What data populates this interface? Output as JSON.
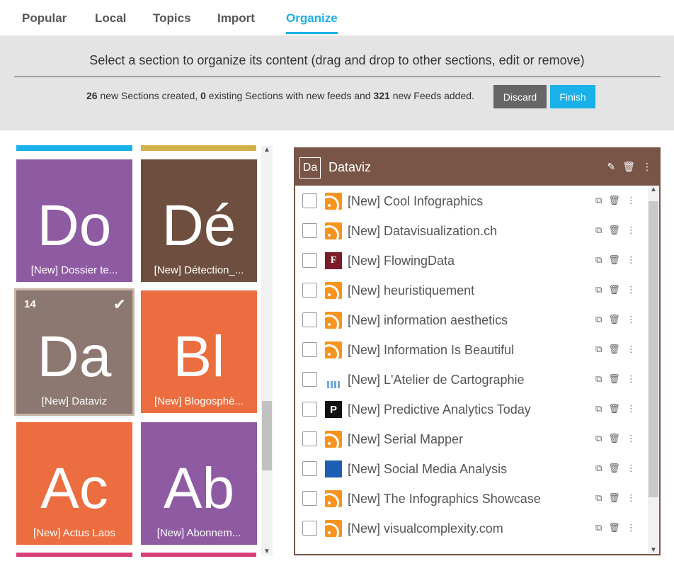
{
  "tabs": [
    "Popular",
    "Local",
    "Topics",
    "Import",
    "Organize"
  ],
  "banner": {
    "title": "Select a section to organize its content (drag and drop to other sections, edit or remove)",
    "new_sections": "26",
    "text1": " new Sections created, ",
    "existing_sections": "0",
    "text2": " existing Sections with new feeds and ",
    "new_feeds": "321",
    "text3": " new Feeds added.",
    "discard": "Discard",
    "finish": "Finish"
  },
  "tiles": [
    {
      "abbr": "Do",
      "caption": "[New] Dossier te...",
      "color": "#8e5ba3"
    },
    {
      "abbr": "Dé",
      "caption": "[New] Détection_...",
      "color": "#6e4e3f"
    },
    {
      "abbr": "Da",
      "caption": "[New] Dataviz",
      "color": "#8c7870",
      "count": "14",
      "check": "✔"
    },
    {
      "abbr": "Bl",
      "caption": "[New] Blogosphè...",
      "color": "#ec6d3f"
    },
    {
      "abbr": "Ac",
      "caption": "[New] Actus Laos",
      "color": "#ec6d3f"
    },
    {
      "abbr": "Ab",
      "caption": "[New] Abonnem...",
      "color": "#8e5ba3"
    }
  ],
  "panel": {
    "badge": "Da",
    "title": "Dataviz",
    "color": "#795548"
  },
  "feeds": [
    {
      "name": "[New] Cool Infographics",
      "icon": "rss"
    },
    {
      "name": "[New] Datavisualization.ch",
      "icon": "rss"
    },
    {
      "name": "[New] FlowingData",
      "icon": "flowingdata"
    },
    {
      "name": "[New] heuristiquement",
      "icon": "rss"
    },
    {
      "name": "[New] information aesthetics",
      "icon": "rss"
    },
    {
      "name": "[New] Information Is Beautiful",
      "icon": "rss"
    },
    {
      "name": "[New] L'Atelier de Cartographie",
      "icon": "atelier"
    },
    {
      "name": "[New] Predictive Analytics Today",
      "icon": "predictive"
    },
    {
      "name": "[New] Serial Mapper",
      "icon": "rss"
    },
    {
      "name": "[New] Social Media Analysis",
      "icon": "social"
    },
    {
      "name": "[New] The Infographics Showcase",
      "icon": "rss"
    },
    {
      "name": "[New] visualcomplexity.com",
      "icon": "rss"
    }
  ]
}
